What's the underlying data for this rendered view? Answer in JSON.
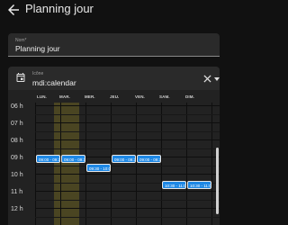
{
  "header": {
    "title": "Planning jour",
    "back_icon": "arrow-left-icon"
  },
  "form": {
    "name_label": "Nom*",
    "name_value": "Planning jour",
    "icon_label": "Icône",
    "icon_value": "mdi:calendar",
    "icon_glyph": "calendar-icon",
    "clear_icon": "close-icon",
    "dropdown_icon": "menu-down-icon"
  },
  "calendar": {
    "days": [
      "LUN.",
      "MAR.",
      "MER.",
      "JEU.",
      "VEN.",
      "SAM.",
      "DIM."
    ],
    "today_index": 1,
    "today_color": "#4a4522",
    "hours": [
      "06 h",
      "07 h",
      "08 h",
      "09 h",
      "10 h",
      "11 h",
      "12 h"
    ],
    "events": [
      {
        "day": 0,
        "text": "09:00 - 09:3"
      },
      {
        "day": 1,
        "text": "09:00 - 09:3"
      },
      {
        "day": 2,
        "text": "09:30 - 10:0"
      },
      {
        "day": 3,
        "text": "09:00 - 09:3"
      },
      {
        "day": 4,
        "text": "09:00 - 09:3"
      },
      {
        "day": 5,
        "text": "10:30 - 11:0"
      },
      {
        "day": 6,
        "text": "10:30 - 11:0"
      }
    ],
    "event_color": "#1e88e5"
  }
}
